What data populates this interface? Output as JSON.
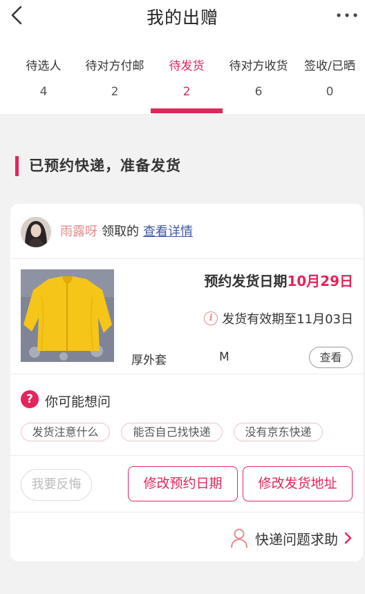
{
  "header": {
    "title": "我的出赠"
  },
  "tabs": [
    {
      "label": "待选人",
      "count": "4"
    },
    {
      "label": "待对方付邮",
      "count": "2"
    },
    {
      "label": "待发货",
      "count": "2"
    },
    {
      "label": "待对方收货",
      "count": "6"
    },
    {
      "label": "签收/已晒",
      "count": "0"
    }
  ],
  "section": {
    "title": "已预约快递，准备发货"
  },
  "order": {
    "giver_name": "雨露呀",
    "giver_suffix": "领取的",
    "detail_link": "查看详情",
    "ship_date_label": "预约发货日期",
    "ship_date_value": "10月29日",
    "validity": "发货有效期至11月03日",
    "product_name": "厚外套",
    "product_size": "M",
    "view_label": "查看"
  },
  "faq": {
    "title": "你可能想问",
    "chips": [
      "发货注意什么",
      "能否自己找快递",
      "没有京东快递"
    ]
  },
  "actions": {
    "regret": "我要反悔",
    "change_date": "修改预约日期",
    "change_address": "修改发货地址"
  },
  "help": {
    "label": "快递问题求助"
  },
  "colors": {
    "accent": "#e4245a",
    "giver_name": "#e58b8b",
    "link": "#3d5a9e"
  }
}
